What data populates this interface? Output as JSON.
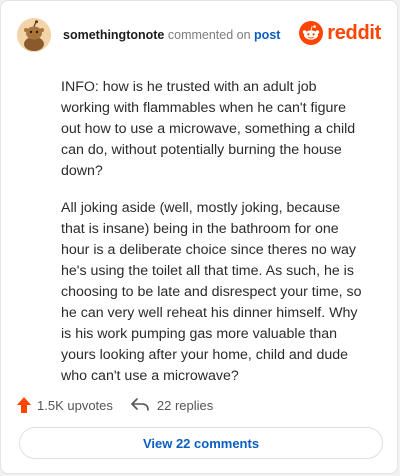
{
  "header": {
    "username": "somethingtonote",
    "action_text": "commented on",
    "post_link": "post",
    "brand": "reddit"
  },
  "comment": {
    "paragraphs": [
      "INFO: how is he trusted with an adult job working with flammables when he can't figure out how to use a microwave, something a child can do, without potentially burning the house down?",
      "All joking aside (well, mostly joking, because that is insane) being in the bathroom for one hour is a deliberate choice since theres no way he's using the toilet all that time. As such, he is choosing to be late and disrespect your time, so he can very well reheat his dinner himself. Why is his work pumping gas more valuable than yours looking after your home, child and dude who can't use a microwave?"
    ]
  },
  "footer": {
    "upvotes": "1.5K upvotes",
    "replies": "22 replies",
    "view_comments": "View 22 comments"
  },
  "colors": {
    "brand": "#ff4500",
    "link": "#0a5ec2"
  }
}
